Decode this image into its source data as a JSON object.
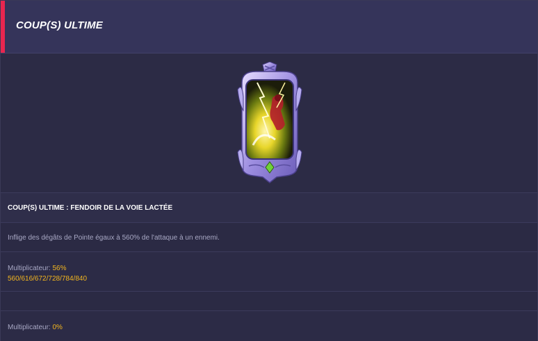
{
  "header": {
    "title": "COUP(S) ULTIME",
    "accent_color": "#e8264f"
  },
  "artwork": {
    "icon": "skill-card-art"
  },
  "skill": {
    "name": "COUP(S) ULTIME : FENDOIR DE LA VOIE LACTÉE",
    "description": "Inflige des dégâts de Pointe égaux à 560% de l'attaque à un ennemi."
  },
  "multiplier1": {
    "label": "Multiplicateur: ",
    "value": "56%",
    "levels": "560/616/672/728/784/840"
  },
  "multiplier2": {
    "label": "Multiplicateur: ",
    "value": "0%"
  },
  "colors": {
    "highlight": "#f3b61f",
    "text_muted": "#a8a8c4",
    "background": "#2c2b45"
  }
}
